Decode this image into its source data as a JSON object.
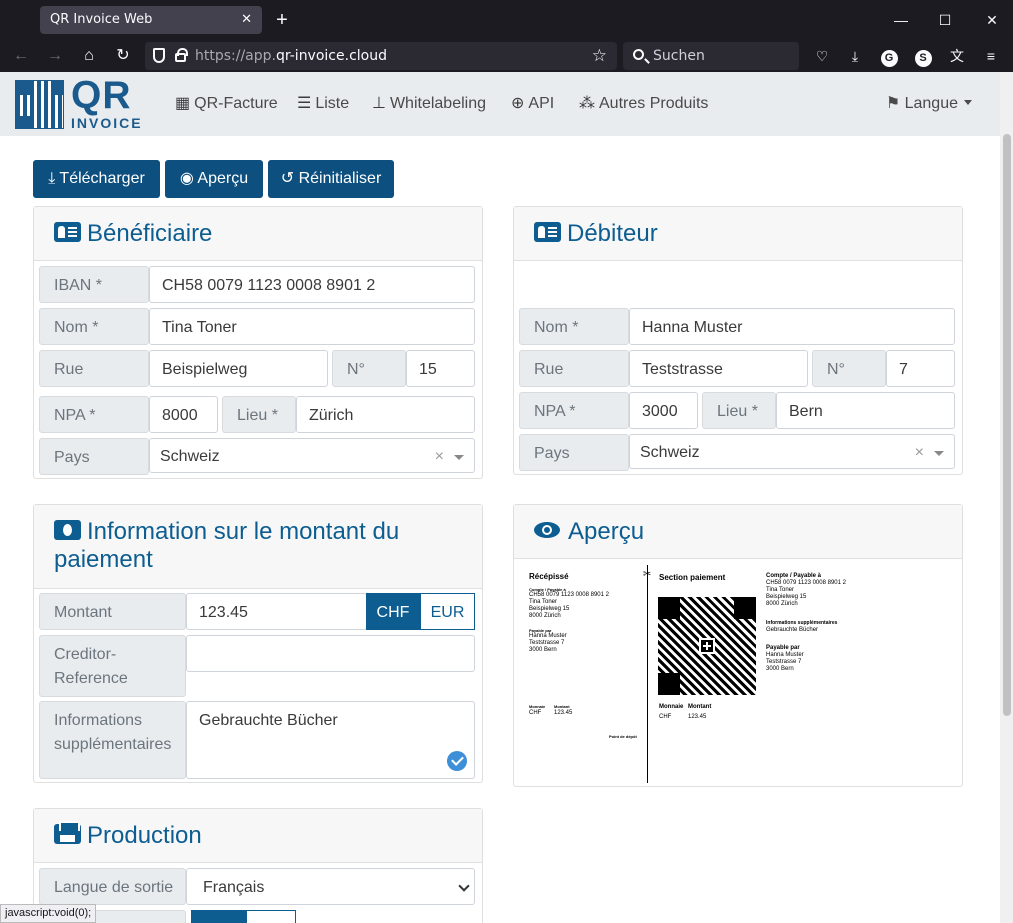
{
  "browser": {
    "tab_title": "QR Invoice Web",
    "tab_close": "✕",
    "new_tab": "+",
    "url_prefix": "https://app.",
    "url_host": "qr-invoice.cloud",
    "search_placeholder": "Suchen",
    "status_text": "javascript:void(0);"
  },
  "navbar": {
    "logo_main": "QR",
    "logo_sub": "INVOICE",
    "items": [
      {
        "icon": "qrcode-icon",
        "label": "QR-Facture"
      },
      {
        "icon": "list-icon",
        "label": "Liste"
      },
      {
        "icon": "thumbtack-icon",
        "label": "Whitelabeling"
      },
      {
        "icon": "globe-icon",
        "label": "API"
      },
      {
        "icon": "cubes-icon",
        "label": "Autres Produits"
      }
    ],
    "language": "Langue"
  },
  "toolbar": {
    "download": "Télécharger",
    "preview": "Aperçu",
    "reset": "Réinitialiser"
  },
  "creditor": {
    "title": "Bénéficiaire",
    "iban_label": "IBAN *",
    "iban": "CH58 0079 1123 0008 8901 2",
    "name_label": "Nom *",
    "name": "Tina Toner",
    "street_label": "Rue",
    "street": "Beispielweg",
    "number_label": "N°",
    "number": "15",
    "zip_label": "NPA *",
    "zip": "8000",
    "city_label": "Lieu *",
    "city": "Zürich",
    "country_label": "Pays",
    "country": "Schweiz"
  },
  "debtor": {
    "title": "Débiteur",
    "name_label": "Nom *",
    "name": "Hanna Muster",
    "street_label": "Rue",
    "street": "Teststrasse",
    "number_label": "N°",
    "number": "7",
    "zip_label": "NPA *",
    "zip": "3000",
    "city_label": "Lieu *",
    "city": "Bern",
    "country_label": "Pays",
    "country": "Schweiz"
  },
  "payment": {
    "title": "Information sur le montant du paiement",
    "amount_label": "Montant",
    "amount": "123.45",
    "currency_chf": "CHF",
    "currency_eur": "EUR",
    "reference_label": "Creditor-Reference",
    "reference_label_l1": "Creditor-",
    "reference_label_l2": "Reference",
    "reference": "",
    "info_label_l1": "Informations",
    "info_label_l2": "supplémentaires",
    "info": "Gebrauchte Bücher"
  },
  "preview": {
    "title": "Aperçu",
    "receipt_title": "Récépissé",
    "receipt_account_label": "Compte / Payable à",
    "receipt_account": "CH58 0079 1123 0008 8901 2",
    "receipt_name": "Tina Toner",
    "receipt_street": "Beispielweg 15",
    "receipt_city": "8000 Zürich",
    "receipt_payer_label": "Payable par",
    "receipt_payer_name": "Hanna Muster",
    "receipt_payer_street": "Teststrasse 7",
    "receipt_payer_city": "3000 Bern",
    "currency_label": "Monnaie",
    "amount_label": "Montant",
    "currency": "CHF",
    "amount": "123.45",
    "deposit_point": "Point de dépôt",
    "section_title": "Section paiement",
    "account_label": "Compte / Payable à",
    "account": "CH58 0079 1123 0008 8901 2",
    "name": "Tina Toner",
    "street": "Beispielweg 15",
    "city": "8000 Zürich",
    "info_label": "Informations supplémentaires",
    "info": "Gebrauchte Bücher",
    "payer_label": "Payable par",
    "payer_name": "Hanna Muster",
    "payer_street": "Teststrasse 7",
    "payer_city": "3000 Bern"
  },
  "production": {
    "title": "Production",
    "language_label": "Langue de sortie",
    "language": "Français"
  },
  "colors": {
    "primary": "#0d4f7f",
    "heading": "#0d5d91",
    "navbar_bg": "#e9ecef",
    "browser_bg": "#1c1b22"
  }
}
